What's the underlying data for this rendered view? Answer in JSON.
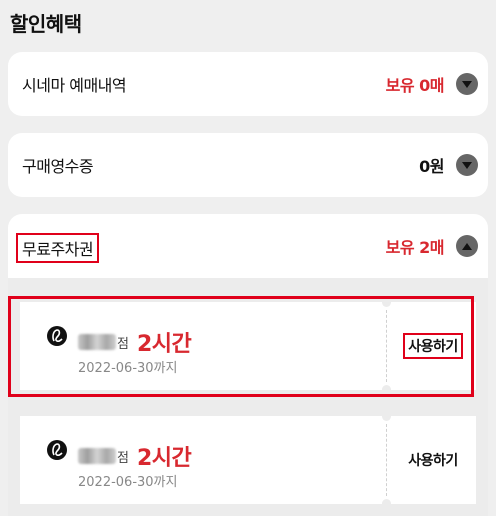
{
  "page": {
    "title": "할인혜택"
  },
  "rows": {
    "cinema": {
      "label": "시네마 예매내역",
      "value": "보유 0매"
    },
    "receipt": {
      "label": "구매영수증",
      "value": "0원"
    },
    "parking": {
      "label": "무료주차권",
      "value": "보유 2매"
    }
  },
  "coupons": [
    {
      "branch_suffix": "점",
      "time": "2시간",
      "expiry": "2022-06-30까지",
      "action": "사용하기"
    },
    {
      "branch_suffix": "점",
      "time": "2시간",
      "expiry": "2022-06-30까지",
      "action": "사용하기"
    }
  ],
  "colors": {
    "accent": "#d8282f",
    "highlight": "#e0001a"
  },
  "icons": {
    "expand": "chevron-down-icon",
    "collapse": "chevron-up-icon",
    "brand": "lotte-logo-icon"
  }
}
